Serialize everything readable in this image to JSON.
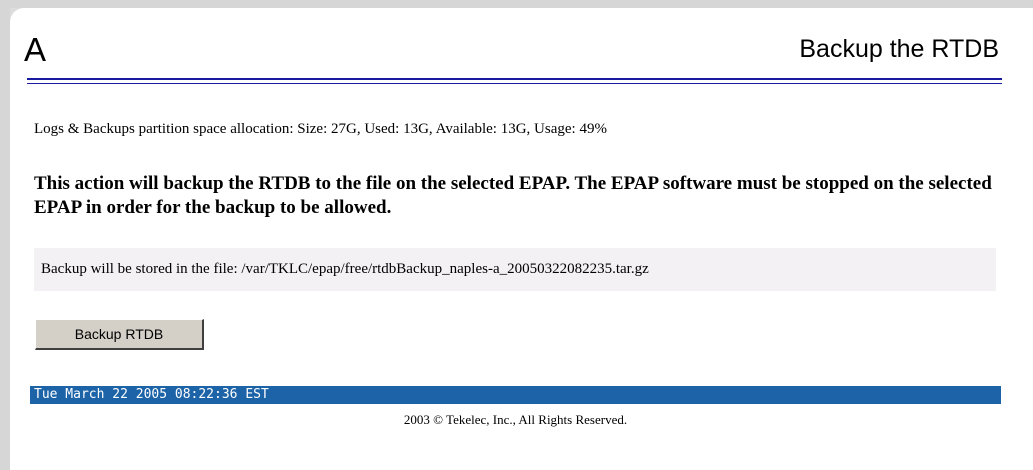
{
  "header": {
    "side_letter": "A",
    "title": "Backup the RTDB"
  },
  "partition_info": "Logs & Backups partition space allocation: Size: 27G, Used: 13G, Available: 13G, Usage: 49%",
  "warning": "This action will backup the RTDB to the file on the selected EPAP. The EPAP software must be stopped on the selected EPAP in order for the backup to be allowed.",
  "backup_file": "Backup will be stored in the file: /var/TKLC/epap/free/rtdbBackup_naples-a_20050322082235.tar.gz",
  "backup_button_label": "Backup RTDB",
  "status_bar": {
    "datetime": "Tue March 22 2005 08:22:36 EST",
    "color": "#1c63a8"
  },
  "footer": {
    "copyright": "2003 © Tekelec, Inc., All Rights Reserved."
  },
  "colors": {
    "rule": "#1a1aa0",
    "file_box_bg": "#f4f1f5"
  }
}
